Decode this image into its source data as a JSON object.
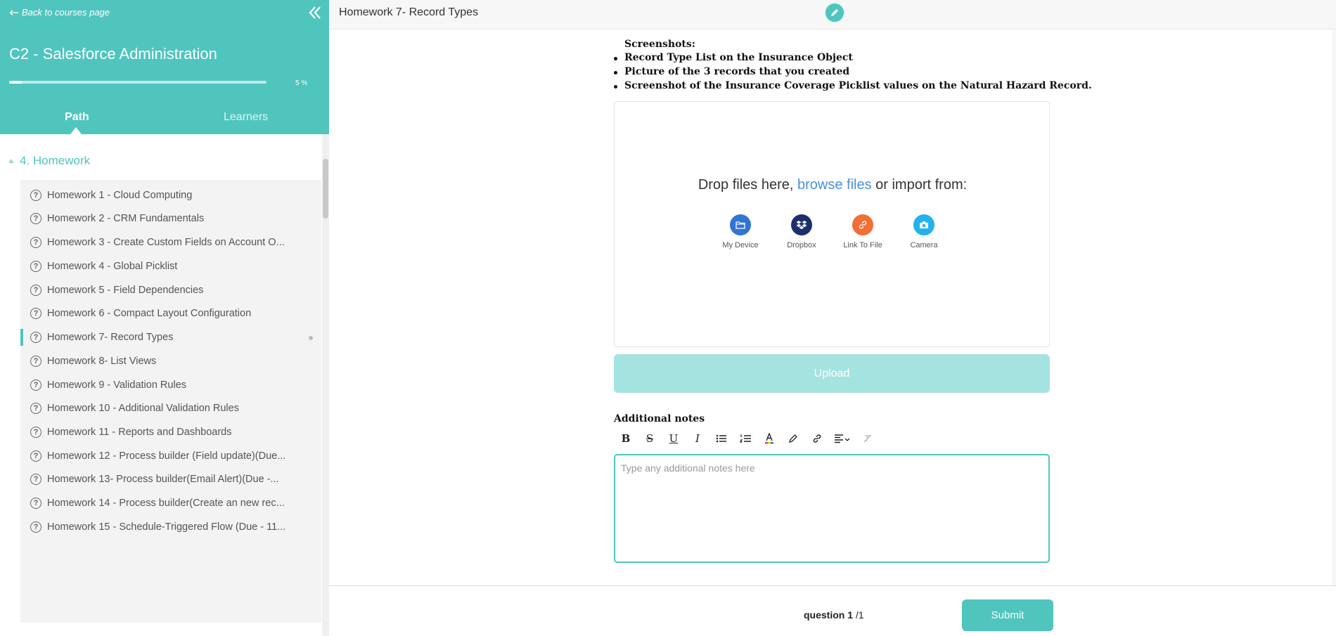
{
  "sidebar": {
    "back_label": "Back to courses page",
    "course_title": "C2 - Salesforce Administration",
    "progress_text": "5 %",
    "progress_fraction": 0.05,
    "tabs": {
      "path": "Path",
      "learners": "Learners"
    },
    "section_title": "4. Homework",
    "items": [
      {
        "label": "Homework 1 - Cloud Computing"
      },
      {
        "label": "Homework 2 - CRM Fundamentals"
      },
      {
        "label": "Homework 3 - Create Custom Fields on Account O..."
      },
      {
        "label": "Homework 4 - Global Picklist"
      },
      {
        "label": "Homework 5 - Field Dependencies"
      },
      {
        "label": "Homework 6 - Compact Layout Configuration"
      },
      {
        "label": "Homework 7- Record Types",
        "active": true
      },
      {
        "label": "Homework 8- List Views"
      },
      {
        "label": "Homework 9 - Validation Rules"
      },
      {
        "label": "Homework 10 - Additional Validation Rules"
      },
      {
        "label": "Homework 11 - Reports and Dashboards"
      },
      {
        "label": "Homework 12 - Process builder (Field update)(Due..."
      },
      {
        "label": "Homework 13- Process builder(Email Alert)(Due -..."
      },
      {
        "label": "Homework 14 - Process builder(Create an new rec..."
      },
      {
        "label": "Homework 15 - Schedule-Triggered Flow (Due - 11..."
      }
    ]
  },
  "header": {
    "title": "Homework 7- Record Types"
  },
  "main": {
    "screenshots_label": "Screenshots:",
    "requirements": [
      "Record Type List on the Insurance Object",
      "Picture of the 3 records that you created",
      "Screenshot of the Insurance Coverage Picklist values on the Natural Hazard Record."
    ],
    "dropzone": {
      "text_before": "Drop files here, ",
      "link": "browse files",
      "text_after": " or import from:",
      "sources": [
        {
          "label": "My Device",
          "icon": "folder-icon"
        },
        {
          "label": "Dropbox",
          "icon": "dropbox-icon"
        },
        {
          "label": "Link To File",
          "icon": "link-icon"
        },
        {
          "label": "Camera",
          "icon": "camera-icon"
        }
      ]
    },
    "upload_label": "Upload",
    "notes_label": "Additional notes",
    "notes_placeholder": "Type any additional notes here"
  },
  "footer": {
    "question_word": "question",
    "question_current": "1",
    "question_total": "/1",
    "submit_label": "Submit"
  },
  "colors": {
    "accent": "#4fc5be",
    "upload_disabled": "#a5e3e0",
    "link": "#4a90e2"
  }
}
